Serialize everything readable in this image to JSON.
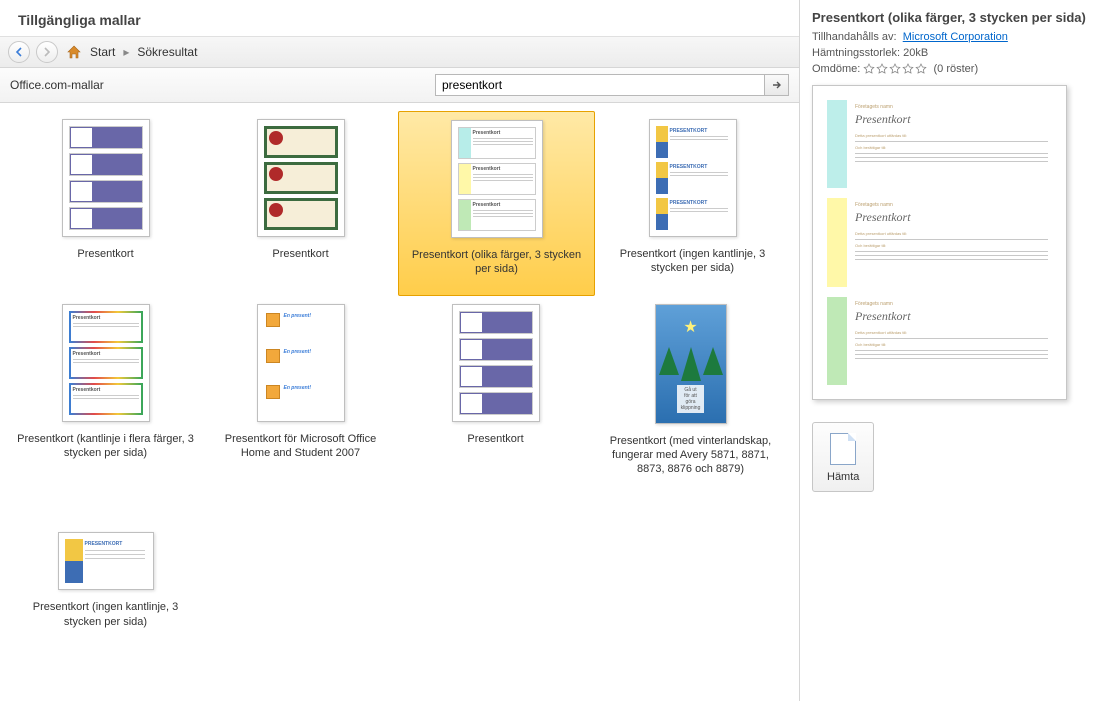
{
  "header": {
    "title": "Tillgängliga mallar"
  },
  "breadcrumb": {
    "home": "Start",
    "current": "Sökresultat"
  },
  "search": {
    "source_label": "Office.com-mallar",
    "value": "presentkort"
  },
  "templates": [
    {
      "label": "Presentkort"
    },
    {
      "label": "Presentkort"
    },
    {
      "label": "Presentkort (olika färger, 3 stycken per sida)",
      "selected": true
    },
    {
      "label": "Presentkort (ingen kantlinje, 3 stycken per sida)"
    },
    {
      "label": "Presentkort (kantlinje i flera färger, 3 stycken per sida)"
    },
    {
      "label": "Presentkort för Microsoft Office Home and Student 2007"
    },
    {
      "label": "Presentkort"
    },
    {
      "label": "Presentkort (med vinterlandskap, fungerar med Avery 5871, 8871, 8873, 8876 och 8879)"
    },
    {
      "label": "Presentkort (ingen kantlinje, 3 stycken per sida)"
    }
  ],
  "details": {
    "title": "Presentkort (olika färger, 3 stycken per sida)",
    "provided_by_label": "Tillhandahålls av:",
    "provider": "Microsoft Corporation",
    "size_label": "Hämtningsstorlek:",
    "size_value": "20kB",
    "rating_label": "Omdöme:",
    "rating_votes": "(0 röster)",
    "preview_heading": "Presentkort",
    "download_label": "Hämta"
  }
}
